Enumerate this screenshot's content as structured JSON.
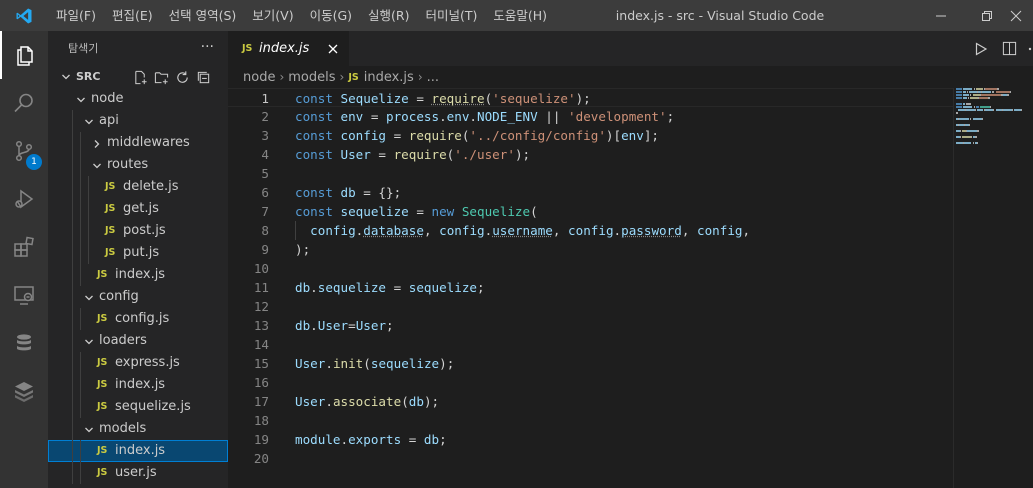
{
  "title_bar": {
    "menu": [
      "파일(F)",
      "편집(E)",
      "선택 영역(S)",
      "보기(V)",
      "이동(G)",
      "실행(R)",
      "터미널(T)",
      "도움말(H)"
    ],
    "window_title": "index.js - src - Visual Studio Code"
  },
  "activity_bar": {
    "icons": [
      "explorer-icon",
      "search-icon",
      "source-control-icon",
      "run-debug-icon",
      "extensions-icon",
      "remote-explorer-icon",
      "database-icon",
      "docker-icon"
    ],
    "source_control_badge": "1"
  },
  "sidebar": {
    "title": "탐색기",
    "more": "···",
    "folder": "SRC",
    "tree": [
      {
        "label": "node",
        "type": "folder",
        "depth": 0,
        "expanded": true
      },
      {
        "label": "api",
        "type": "folder",
        "depth": 1,
        "expanded": true
      },
      {
        "label": "middlewares",
        "type": "folder",
        "depth": 2,
        "expanded": false
      },
      {
        "label": "routes",
        "type": "folder",
        "depth": 2,
        "expanded": true
      },
      {
        "label": "delete.js",
        "type": "file",
        "depth": 3
      },
      {
        "label": "get.js",
        "type": "file",
        "depth": 3
      },
      {
        "label": "post.js",
        "type": "file",
        "depth": 3
      },
      {
        "label": "put.js",
        "type": "file",
        "depth": 3
      },
      {
        "label": "index.js",
        "type": "file",
        "depth": 2
      },
      {
        "label": "config",
        "type": "folder",
        "depth": 1,
        "expanded": true
      },
      {
        "label": "config.js",
        "type": "file",
        "depth": 2
      },
      {
        "label": "loaders",
        "type": "folder",
        "depth": 1,
        "expanded": true
      },
      {
        "label": "express.js",
        "type": "file",
        "depth": 2
      },
      {
        "label": "index.js",
        "type": "file",
        "depth": 2
      },
      {
        "label": "sequelize.js",
        "type": "file",
        "depth": 2
      },
      {
        "label": "models",
        "type": "folder",
        "depth": 1,
        "expanded": true
      },
      {
        "label": "index.js",
        "type": "file",
        "depth": 2,
        "selected": true
      },
      {
        "label": "user.js",
        "type": "file",
        "depth": 2
      }
    ]
  },
  "editor": {
    "tab": {
      "icon_text": "JS",
      "label": "index.js"
    },
    "breadcrumb": [
      "node",
      "models",
      "index.js",
      "..."
    ],
    "file_icon_text": "JS",
    "current_line": 1,
    "lines": [
      [
        [
          "kw",
          "const "
        ],
        [
          "var",
          "Sequelize"
        ],
        [
          "pl",
          " = "
        ],
        [
          "fn squig",
          "require"
        ],
        [
          "pl",
          "("
        ],
        [
          "str",
          "'sequelize'"
        ],
        [
          "pl",
          ");"
        ]
      ],
      [
        [
          "kw",
          "const "
        ],
        [
          "var",
          "env"
        ],
        [
          "pl",
          " = "
        ],
        [
          "var",
          "process"
        ],
        [
          "pl",
          "."
        ],
        [
          "var",
          "env"
        ],
        [
          "pl",
          "."
        ],
        [
          "var",
          "NODE_ENV"
        ],
        [
          "pl",
          " || "
        ],
        [
          "str",
          "'development'"
        ],
        [
          "pl",
          ";"
        ]
      ],
      [
        [
          "kw",
          "const "
        ],
        [
          "var",
          "config"
        ],
        [
          "pl",
          " = "
        ],
        [
          "fn",
          "require"
        ],
        [
          "pl",
          "("
        ],
        [
          "str",
          "'../config/config'"
        ],
        [
          "pl",
          ")["
        ],
        [
          "var",
          "env"
        ],
        [
          "pl",
          "];"
        ]
      ],
      [
        [
          "kw",
          "const "
        ],
        [
          "var",
          "User"
        ],
        [
          "pl",
          " = "
        ],
        [
          "fn",
          "require"
        ],
        [
          "pl",
          "("
        ],
        [
          "str",
          "'./user'"
        ],
        [
          "pl",
          ");"
        ]
      ],
      [],
      [
        [
          "kw",
          "const "
        ],
        [
          "var",
          "db"
        ],
        [
          "pl",
          " = {};"
        ]
      ],
      [
        [
          "kw",
          "const "
        ],
        [
          "var",
          "sequelize"
        ],
        [
          "pl",
          " = "
        ],
        [
          "kw",
          "new "
        ],
        [
          "cls",
          "Sequelize"
        ],
        [
          "pl",
          "("
        ]
      ],
      [
        [
          "pl",
          "  "
        ],
        [
          "var",
          "config"
        ],
        [
          "pl",
          "."
        ],
        [
          "var squig",
          "database"
        ],
        [
          "pl",
          ", "
        ],
        [
          "var",
          "config"
        ],
        [
          "pl",
          "."
        ],
        [
          "var squig",
          "username"
        ],
        [
          "pl",
          ", "
        ],
        [
          "var",
          "config"
        ],
        [
          "pl",
          "."
        ],
        [
          "var squig",
          "password"
        ],
        [
          "pl",
          ", "
        ],
        [
          "var",
          "config"
        ],
        [
          "pl",
          ","
        ]
      ],
      [
        [
          "pl",
          ");"
        ]
      ],
      [],
      [
        [
          "var",
          "db"
        ],
        [
          "pl",
          "."
        ],
        [
          "var",
          "sequelize"
        ],
        [
          "pl",
          " = "
        ],
        [
          "var",
          "sequelize"
        ],
        [
          "pl",
          ";"
        ]
      ],
      [],
      [
        [
          "var",
          "db"
        ],
        [
          "pl",
          "."
        ],
        [
          "var",
          "User"
        ],
        [
          "pl",
          "="
        ],
        [
          "var",
          "User"
        ],
        [
          "pl",
          ";"
        ]
      ],
      [],
      [
        [
          "var",
          "User"
        ],
        [
          "pl",
          "."
        ],
        [
          "fn",
          "init"
        ],
        [
          "pl",
          "("
        ],
        [
          "var",
          "sequelize"
        ],
        [
          "pl",
          ");"
        ]
      ],
      [],
      [
        [
          "var",
          "User"
        ],
        [
          "pl",
          "."
        ],
        [
          "fn",
          "associate"
        ],
        [
          "pl",
          "("
        ],
        [
          "var",
          "db"
        ],
        [
          "pl",
          ");"
        ]
      ],
      [],
      [
        [
          "var",
          "module"
        ],
        [
          "pl",
          "."
        ],
        [
          "var",
          "exports"
        ],
        [
          "pl",
          " = "
        ],
        [
          "var",
          "db"
        ],
        [
          "pl",
          ";"
        ]
      ],
      []
    ]
  }
}
